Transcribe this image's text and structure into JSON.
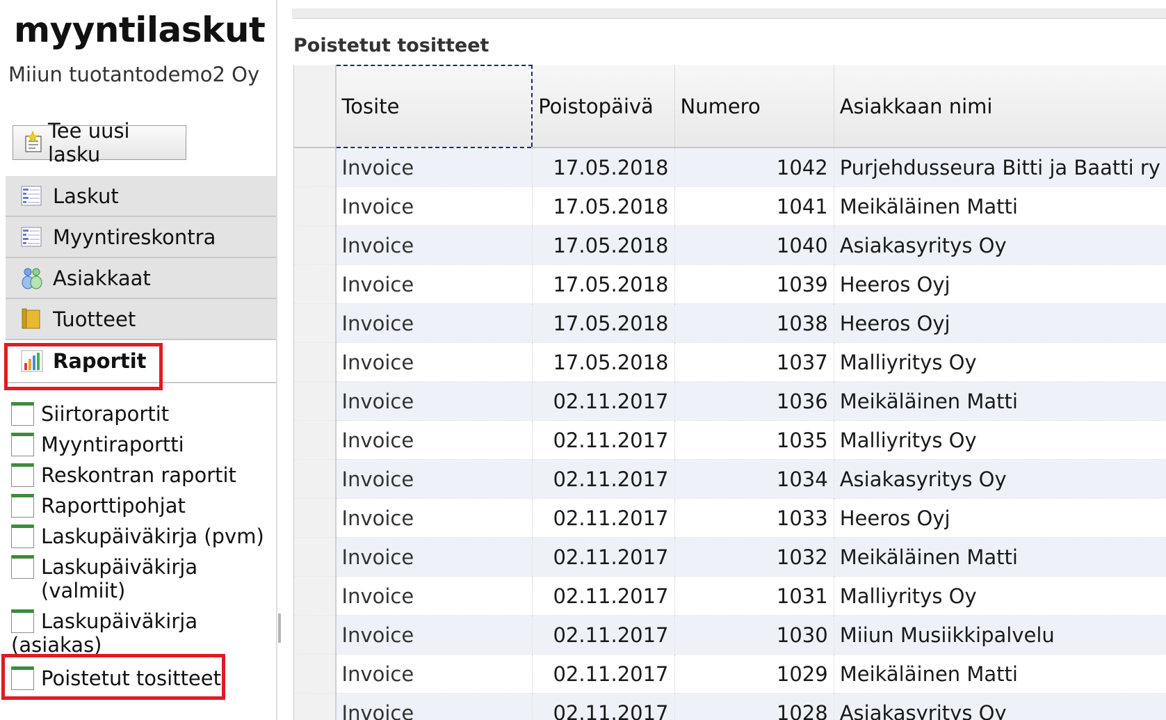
{
  "app": {
    "title": "myyntilaskut",
    "company": "Miiun tuotantodemo2 Oy"
  },
  "toolbar": {
    "new_invoice_label": "Tee uusi lasku"
  },
  "nav": [
    {
      "label": "Laskut",
      "icon": "list-icon"
    },
    {
      "label": "Myyntireskontra",
      "icon": "list-icon"
    },
    {
      "label": "Asiakkaat",
      "icon": "people-icon"
    },
    {
      "label": "Tuotteet",
      "icon": "box-icon"
    },
    {
      "label": "Raportit",
      "icon": "bar-chart-icon",
      "active": true
    }
  ],
  "reports": [
    "Siirtoraportit",
    "Myyntiraportti",
    "Reskontran raportit",
    "Raporttipohjat",
    "Laskupäiväkirja (pvm)",
    "Laskupäiväkirja (valmiit)",
    "Laskupäiväkirja (asiakas)",
    "Poistetut tositteet"
  ],
  "page": {
    "title": "Poistetut tositteet"
  },
  "table": {
    "columns": [
      "Tosite",
      "Poistopäivä",
      "Numero",
      "Asiakkaan nimi"
    ],
    "rows": [
      [
        "Invoice",
        "17.05.2018",
        "1042",
        "Purjehdusseura Bitti ja Baatti ry"
      ],
      [
        "Invoice",
        "17.05.2018",
        "1041",
        "Meikäläinen Matti"
      ],
      [
        "Invoice",
        "17.05.2018",
        "1040",
        "Asiakasyritys Oy"
      ],
      [
        "Invoice",
        "17.05.2018",
        "1039",
        "Heeros Oyj"
      ],
      [
        "Invoice",
        "17.05.2018",
        "1038",
        "Heeros Oyj"
      ],
      [
        "Invoice",
        "17.05.2018",
        "1037",
        "Malliyritys Oy"
      ],
      [
        "Invoice",
        "02.11.2017",
        "1036",
        "Meikäläinen Matti"
      ],
      [
        "Invoice",
        "02.11.2017",
        "1035",
        "Malliyritys Oy"
      ],
      [
        "Invoice",
        "02.11.2017",
        "1034",
        "Asiakasyritys Oy"
      ],
      [
        "Invoice",
        "02.11.2017",
        "1033",
        "Heeros Oyj"
      ],
      [
        "Invoice",
        "02.11.2017",
        "1032",
        "Meikäläinen Matti"
      ],
      [
        "Invoice",
        "02.11.2017",
        "1031",
        "Malliyritys Oy"
      ],
      [
        "Invoice",
        "02.11.2017",
        "1030",
        "Miiun Musiikkipalvelu"
      ],
      [
        "Invoice",
        "02.11.2017",
        "1029",
        "Meikäläinen Matti"
      ],
      [
        "Invoice",
        "02.11.2017",
        "1028",
        "Asiakasyritys Oy"
      ]
    ]
  },
  "colors": {
    "highlight": "#e01b24",
    "row_alt": "#eef2f8",
    "sheet_green": "#3f8a3f"
  }
}
